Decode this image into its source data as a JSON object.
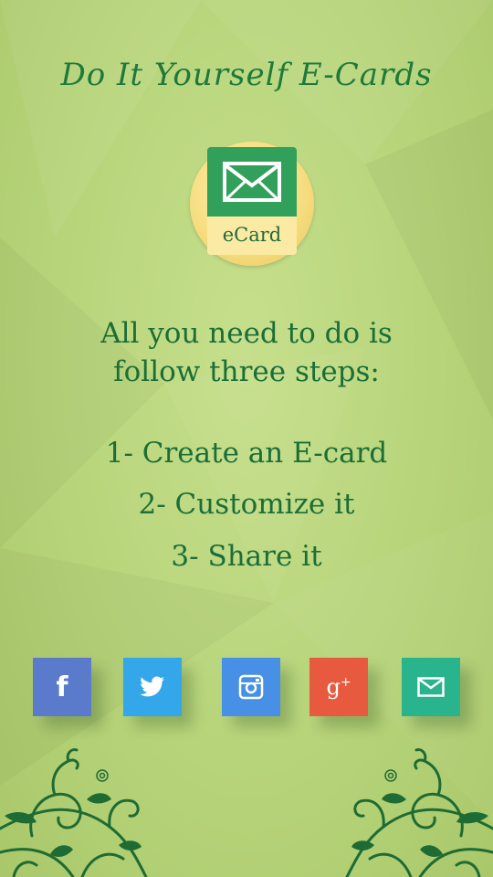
{
  "app": {
    "title": "Do It Yourself E-Cards"
  },
  "logo": {
    "label": "eCard",
    "icon": "envelope-icon"
  },
  "intro": {
    "line1": "All you need to do is",
    "line2": "follow three steps:"
  },
  "steps": [
    "1- Create an E-card",
    "2- Customize it",
    "3- Share it"
  ],
  "social": [
    {
      "icon": "facebook-icon",
      "color": "#5a7bcc"
    },
    {
      "icon": "twitter-icon",
      "color": "#33a7ea"
    },
    {
      "icon": "instagram-icon",
      "color": "#4790e5"
    },
    {
      "icon": "google-plus-icon",
      "color": "#e85a40"
    },
    {
      "icon": "email-icon",
      "color": "#29b48d"
    }
  ],
  "colors": {
    "background": "#b7d47a",
    "text": "#1b6e37",
    "title": "#1e7a3a",
    "vine": "#1f6b34"
  }
}
